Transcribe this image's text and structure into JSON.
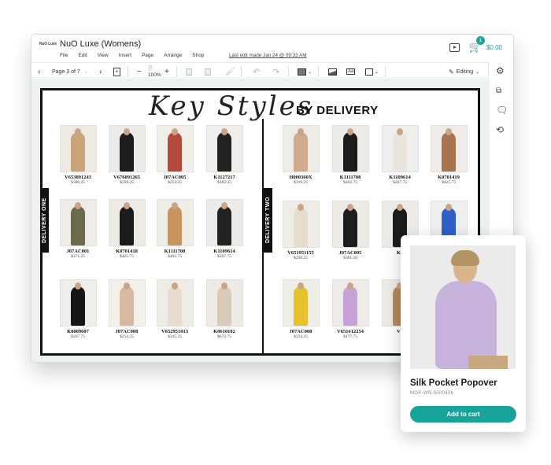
{
  "app": {
    "logo_text": "NuO Luxe",
    "title": "NuO Luxe (Womens)",
    "menu": [
      "File",
      "Edit",
      "View",
      "Insert",
      "Page",
      "Arrange",
      "Shop"
    ],
    "last_edit": "Last edit made Jan 24 @ 09:33 AM",
    "cart_count": "1",
    "cart_total": "$0.00"
  },
  "toolbar": {
    "page_indicator": "Page 3 of 7",
    "zoom": "100%",
    "mode": "Editing"
  },
  "page": {
    "title_script": "Key Styles",
    "title_sub": "BY DELIVERY",
    "delivery_one": "DELIVERY ONE",
    "delivery_two": "DELIVERY TWO",
    "products": [
      {
        "sku": "V653891243",
        "price": "$380.25"
      },
      {
        "sku": "V676091265",
        "price": "$299.25"
      },
      {
        "sku": "J07AC005",
        "price": "$254.25"
      },
      {
        "sku": "K1127217",
        "price": "$182.25"
      },
      {
        "sku": "J07AC001",
        "price": "$371.25"
      },
      {
        "sku": "K0701418",
        "price": "$425.75"
      },
      {
        "sku": "K1111708",
        "price": "$402.75"
      },
      {
        "sku": "K1109614",
        "price": "$267.75"
      },
      {
        "sku": "K0809607",
        "price": "$267.75"
      },
      {
        "sku": "J07AC008",
        "price": "$254.25"
      },
      {
        "sku": "V652951013",
        "price": "$245.25"
      },
      {
        "sku": "K0610102",
        "price": "$672.75"
      },
      {
        "sku": "H000360X",
        "price": "$319.25"
      },
      {
        "sku": "K1111708",
        "price": "$402.75"
      },
      {
        "sku": "K1109614",
        "price": "$267.75"
      },
      {
        "sku": "K0701419",
        "price": "$425.75"
      },
      {
        "sku": "V651951155",
        "price": "$299.25"
      },
      {
        "sku": "J07AC005",
        "price": "$381.50"
      },
      {
        "sku": "K0",
        "price": ""
      },
      {
        "sku": "",
        "price": ""
      },
      {
        "sku": "J07AC008",
        "price": "$254.25"
      },
      {
        "sku": "V651612254",
        "price": "$177.75"
      },
      {
        "sku": "V6",
        "price": ""
      }
    ]
  },
  "card": {
    "name": "Silk Pocket Popover",
    "sku": "MOP-WN-5000406",
    "button": "Add to cart"
  },
  "colors": {
    "accent": "#15a39a",
    "border": "#111111"
  }
}
